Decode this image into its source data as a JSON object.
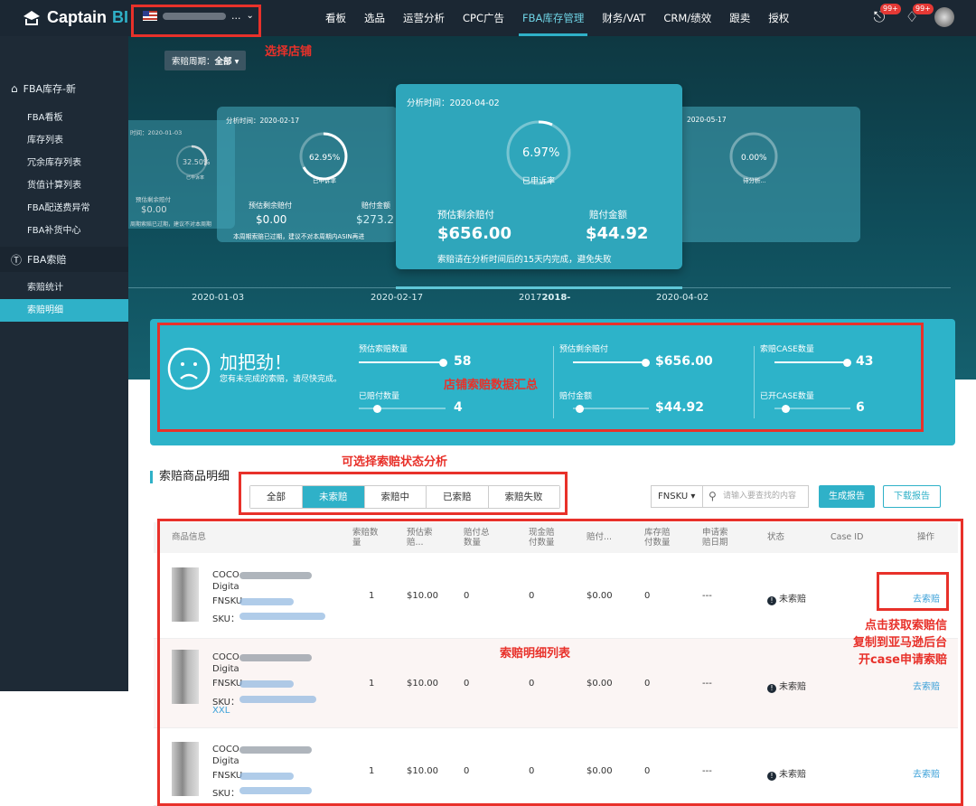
{
  "brand": {
    "name": "Captain",
    "suffix": "BI"
  },
  "store": {
    "selected": "..."
  },
  "nav": {
    "items": [
      "看板",
      "选品",
      "运营分析",
      "CPC广告",
      "FBA库存管理",
      "财务/VAT",
      "CRM/绩效",
      "跟卖",
      "授权"
    ],
    "badge1": "99+",
    "badge2": "99+"
  },
  "annotations": {
    "store": "选择店铺",
    "summary": "店铺索赔数据汇总",
    "status": "可选择索赔状态分析",
    "list": "索赔明细列表",
    "action_line1": "点击获取索赔信",
    "action_line2": "复制到亚马逊后台",
    "action_line3": "开case申请索赔"
  },
  "sidebar": {
    "group1": "FBA库存-新",
    "items1": [
      "FBA看板",
      "库存列表",
      "冗余库存列表",
      "货值计算列表",
      "FBA配送费异常",
      "FBA补货中心"
    ],
    "group2": "FBA索赔",
    "items2": [
      "索赔统计",
      "索赔明细"
    ]
  },
  "period": {
    "label": "索赔周期：",
    "value": "全部"
  },
  "cards": {
    "far_left": {
      "date": "时间：2020-01-03",
      "pct": "32.50%",
      "pct_label": "已申诉率",
      "left_label": "预估剩余赔付",
      "left_value": "$0.00",
      "note": "周期索赔已过期，建议不对本周期"
    },
    "left": {
      "date": "分析时间：2020-02-17",
      "pct": "62.95%",
      "pct_label": "已申诉率",
      "left_label": "预估剩余赔付",
      "left_value": "$0.00",
      "right_label": "赔付金额",
      "right_value": "$273.2",
      "note": "本周期索赔已过期，建议不对本周期内ASIN再进"
    },
    "main": {
      "date": "分析时间：2020-04-02",
      "pct": "6.97%",
      "pct_label": "已申诉率",
      "left_label": "预估剩余赔付",
      "left_value": "$656.00",
      "right_label": "赔付金额",
      "right_value": "$44.92",
      "note": "索赔请在分析时间后的15天内完成，避免失败"
    },
    "right": {
      "date": "2020-05-17",
      "pct": "0.00%",
      "pct_label": "待分析..."
    }
  },
  "timeline": {
    "labels": [
      "2020-01-03",
      "2020-02-17",
      "2017",
      "2018-",
      "2020-04-02"
    ]
  },
  "summary": {
    "headline": "加把劲！",
    "sub": "您有未完成的索赔，请尽快完成。",
    "m1_label": "预估索赔数量",
    "m1_value": "58",
    "m2_label": "已赔付数量",
    "m2_value": "4",
    "m3_label": "预估剩余赔付",
    "m3_value": "$656.00",
    "m4_label": "赔付金额",
    "m4_value": "$44.92",
    "m5_label": "索赔CASE数量",
    "m5_value": "43",
    "m6_label": "已开CASE数量",
    "m6_value": "6"
  },
  "detail": {
    "title": "索赔商品明细",
    "tabs": [
      "全部",
      "未索赔",
      "索赔中",
      "已索赔",
      "索赔失败"
    ],
    "fnsku": "FNSKU",
    "search_placeholder": "请输入要查找的内容",
    "btn_report": "生成报告",
    "btn_download": "下载报告"
  },
  "table": {
    "headers": {
      "info": "商品信息",
      "qty": "索赔数量",
      "est": "预估索赔...",
      "paid": "赔付总数量",
      "cash": "现金赔付数量",
      "amount": "赔付...",
      "stock": "库存赔付数量",
      "date": "申请索赔日期",
      "status": "状态",
      "case": "Case ID",
      "action": "操作"
    },
    "rows": [
      {
        "line1": "COCO",
        "line2": "Digita",
        "fnsku": "FNSKU",
        "sku": "SKU：",
        "extra": "",
        "qty": "1",
        "est": "$10.00",
        "paid": "0",
        "cash": "0",
        "amount": "$0.00",
        "stock": "0",
        "date": "---",
        "status": "未索赔",
        "action": "去索赔"
      },
      {
        "line1": "COCO",
        "line2": "Digita",
        "fnsku": "FNSKU",
        "sku": "SKU：",
        "extra": "XXL",
        "qty": "1",
        "est": "$10.00",
        "paid": "0",
        "cash": "0",
        "amount": "$0.00",
        "stock": "0",
        "date": "---",
        "status": "未索赔",
        "action": "去索赔"
      },
      {
        "line1": "COCO",
        "line2": "Digita",
        "fnsku": "FNSKU",
        "sku": "SKU：",
        "extra": "",
        "qty": "1",
        "est": "$10.00",
        "paid": "0",
        "cash": "0",
        "amount": "$0.00",
        "stock": "0",
        "date": "---",
        "status": "未索赔",
        "action": "去索赔"
      }
    ]
  }
}
